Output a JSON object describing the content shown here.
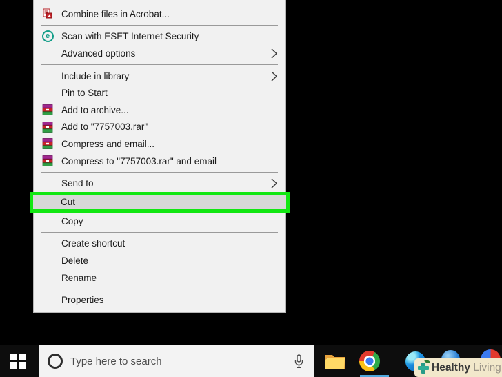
{
  "menu": {
    "highlight_color": "#12e712",
    "items": [
      {
        "id": "combine-files-in-acrobat",
        "label": "Combine files in Acrobat...",
        "icon": "acrobat-combine-icon"
      },
      {
        "id": "scan-with-eset",
        "label": "Scan with ESET Internet Security",
        "icon": "eset-icon"
      },
      {
        "id": "advanced-options",
        "label": "Advanced options",
        "submenu": true
      },
      {
        "id": "include-in-library",
        "label": "Include in library",
        "submenu": true
      },
      {
        "id": "pin-to-start",
        "label": "Pin to Start"
      },
      {
        "id": "add-to-archive",
        "label": "Add to archive...",
        "icon": "winrar-icon"
      },
      {
        "id": "add-to-rar",
        "label": "Add to \"7757003.rar\"",
        "icon": "winrar-icon"
      },
      {
        "id": "compress-and-email",
        "label": "Compress and email...",
        "icon": "winrar-icon"
      },
      {
        "id": "compress-to-rar-and-email",
        "label": "Compress to \"7757003.rar\" and email",
        "icon": "winrar-icon"
      },
      {
        "id": "send-to",
        "label": "Send to",
        "submenu": true
      },
      {
        "id": "cut",
        "label": "Cut",
        "highlighted": true
      },
      {
        "id": "copy",
        "label": "Copy"
      },
      {
        "id": "create-shortcut",
        "label": "Create shortcut"
      },
      {
        "id": "delete",
        "label": "Delete"
      },
      {
        "id": "rename",
        "label": "Rename"
      },
      {
        "id": "properties",
        "label": "Properties"
      }
    ],
    "eset_glyph": "e"
  },
  "taskbar": {
    "search": {
      "placeholder": "Type here to search"
    },
    "icons": [
      "start-icon",
      "cortana-circle-icon",
      "microphone-icon",
      "file-explorer-icon",
      "chrome-icon",
      "edge-icon",
      "blue-app-icon",
      "colorful-app-icon"
    ],
    "active_app_underline_color": "#4fa8dd"
  },
  "watermark": {
    "bold": "Healthy",
    "light": " Living",
    "plus_color": "#279b87",
    "background": "#f2e8cb"
  }
}
